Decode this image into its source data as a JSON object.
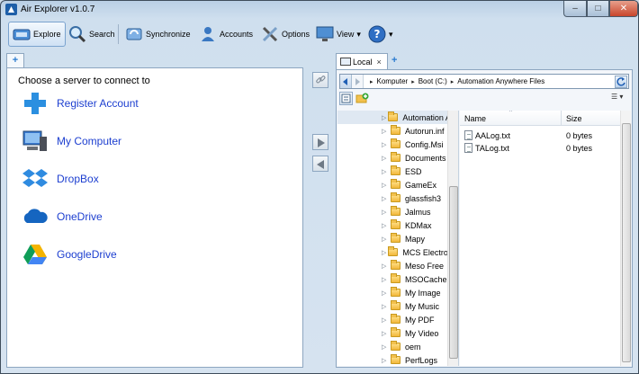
{
  "window": {
    "title": "Air Explorer v1.0.7",
    "controls": {
      "minimize": "–",
      "maximize": "□",
      "close": "✕"
    }
  },
  "toolbar": {
    "explore": "Explore",
    "search": "Search",
    "synchronize": "Synchronize",
    "accounts": "Accounts",
    "options": "Options",
    "view": "View",
    "dropdown_arrow": "▾",
    "help_glyph": "?"
  },
  "left_pane": {
    "add_tab": "+",
    "heading": "Choose a server to connect to",
    "servers": [
      {
        "label": "Register Account",
        "icon": "plus-icon"
      },
      {
        "label": "My Computer",
        "icon": "computer-icon"
      },
      {
        "label": "DropBox",
        "icon": "dropbox-icon"
      },
      {
        "label": "OneDrive",
        "icon": "cloud-icon"
      },
      {
        "label": "GoogleDrive",
        "icon": "google-drive-icon"
      }
    ]
  },
  "right_pane": {
    "tab_label": "Local",
    "tab_close": "×",
    "add_tab": "+",
    "breadcrumb": [
      "Komputer",
      "Boot (C:)",
      "Automation Anywhere Files"
    ],
    "crumb_separator": "▸",
    "view_button": "☰ ▾",
    "tree": [
      "Automation Anywhere Files",
      "Autorun.inf",
      "Config.Msi",
      "Documents",
      "ESD",
      "GameEx",
      "glassfish3",
      "Jalmus",
      "KDMax",
      "Mapy",
      "MCS Electronics",
      "Meso Free",
      "MSOCache",
      "My Image",
      "My Music",
      "My PDF",
      "My Video",
      "oem",
      "PerfLogs"
    ],
    "tree_expander": "▷",
    "columns": {
      "name": "Name",
      "size": "Size",
      "sort_indicator": "^"
    },
    "files": [
      {
        "name": "AALog.txt",
        "size": "0 bytes"
      },
      {
        "name": "TALog.txt",
        "size": "0 bytes"
      }
    ]
  },
  "colors": {
    "link_blue": "#1d3fd0",
    "title_bar": "#b9cfe5",
    "close_red": "#c8452b",
    "folder_yellow": "#f2b83a"
  }
}
